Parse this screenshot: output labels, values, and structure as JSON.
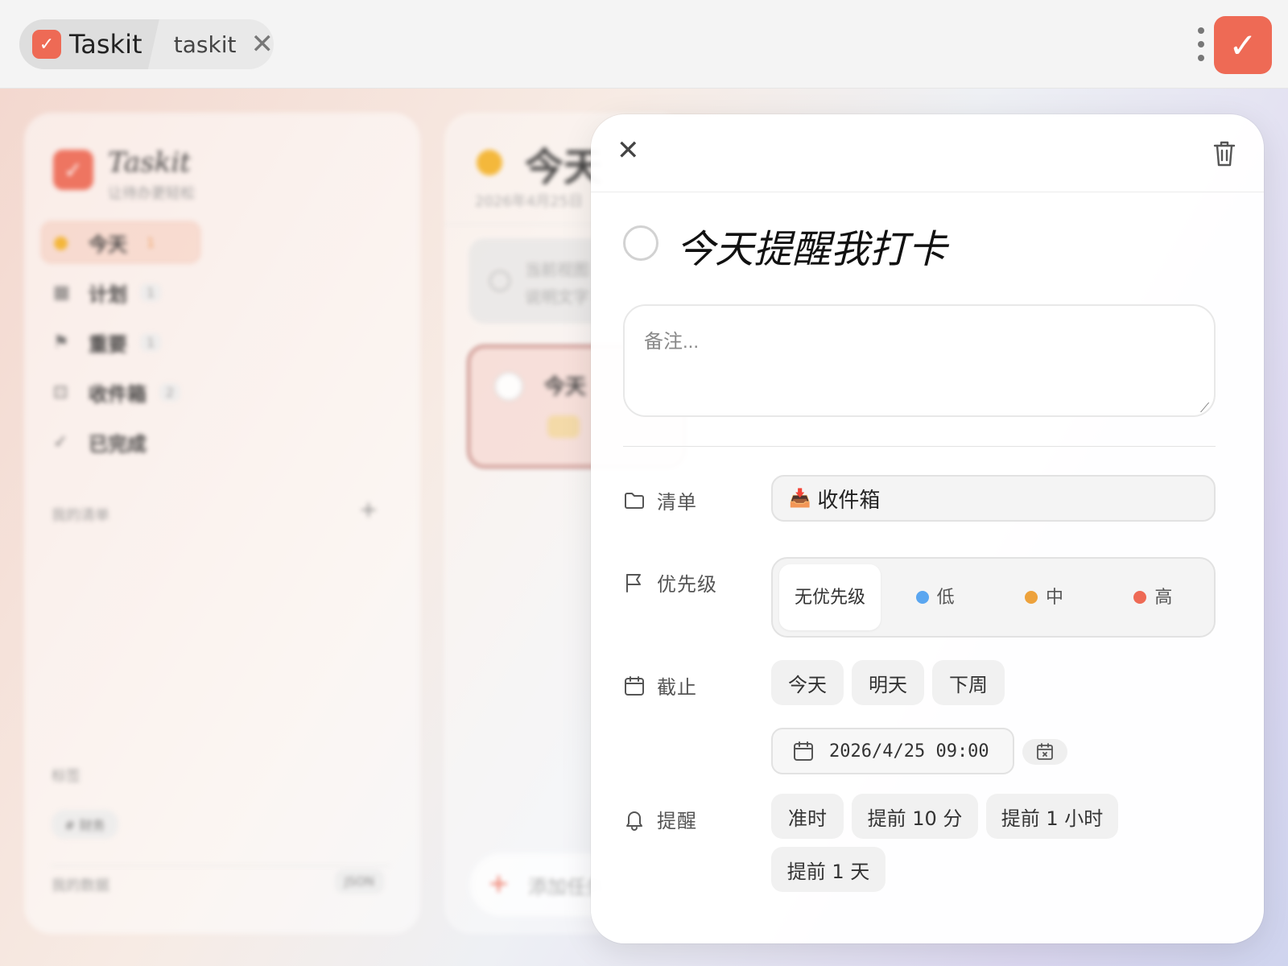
{
  "topbar": {
    "app_title": "Taskit",
    "tab_label": "taskit",
    "close_glyph": "✕",
    "check_glyph": "✓"
  },
  "sidebar": {
    "title": "Taskit",
    "subtitle": "让待办更轻松",
    "items": [
      {
        "label": "今天",
        "count": "1",
        "icon": "sun-icon"
      },
      {
        "label": "计划",
        "count": "1",
        "icon": "calendar-icon"
      },
      {
        "label": "重要",
        "count": "1",
        "icon": "flag-icon"
      },
      {
        "label": "收件箱",
        "count": "2",
        "icon": "inbox-icon"
      },
      {
        "label": "已完成",
        "count": "",
        "icon": "check-icon"
      }
    ],
    "my_lists_label": "我的清单",
    "add_glyph": "+",
    "tags_label": "标签",
    "tag_chip": "# 财务",
    "my_data_label": "我的数据",
    "my_data_button": "JSON"
  },
  "main": {
    "title": "今天",
    "date": "2026年4月25日",
    "hint_card_text": "当前视图\n说明文字",
    "task_card_title": "今天",
    "add_placeholder": "添加任务"
  },
  "detail": {
    "close_glyph": "✕",
    "task_title": "今天提醒我打卡",
    "notes_placeholder": "备注...",
    "list": {
      "label": "清单",
      "emoji": "📥",
      "value": "收件箱"
    },
    "priority": {
      "label": "优先级",
      "options": [
        {
          "label": "无优先级",
          "selected": true,
          "color": ""
        },
        {
          "label": "低",
          "selected": false,
          "color": "#5aa6f0"
        },
        {
          "label": "中",
          "selected": false,
          "color": "#eda23c"
        },
        {
          "label": "高",
          "selected": false,
          "color": "#ee6a55"
        }
      ]
    },
    "due": {
      "label": "截止",
      "quick": [
        "今天",
        "明天",
        "下周"
      ],
      "value": "2026/4/25 09:00"
    },
    "reminder": {
      "label": "提醒",
      "options": [
        "准时",
        "提前 10 分",
        "提前 1 小时",
        "提前 1 天"
      ]
    }
  },
  "colors": {
    "accent": "#ee6a55"
  }
}
